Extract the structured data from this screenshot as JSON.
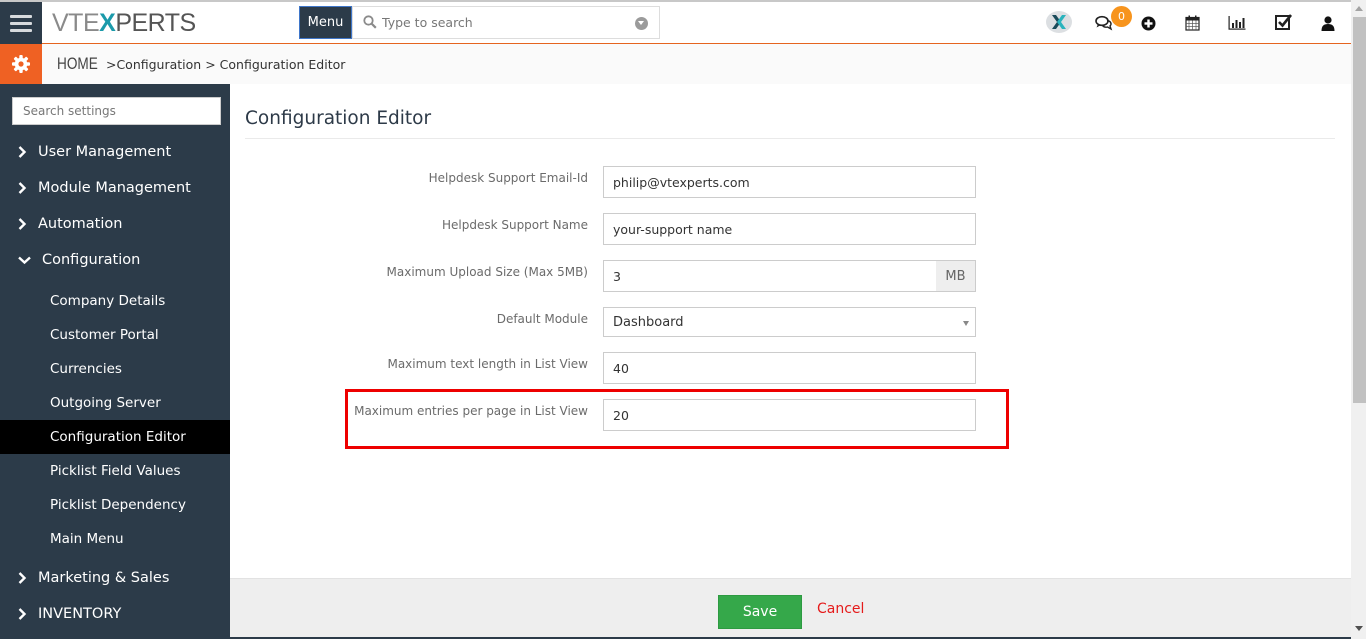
{
  "header": {
    "logo_text": {
      "pre": "VTE",
      "x": "X",
      "post": "PERTS"
    },
    "menu_label": "Menu",
    "search_placeholder": "Type to search",
    "notification_count": "0",
    "icons": [
      "vtexperts-logo-icon",
      "chat-icon",
      "add-circle-icon",
      "calendar-icon",
      "reports-chart-icon",
      "tasks-checkbox-icon",
      "user-icon"
    ]
  },
  "breadcrumb": {
    "home": "HOME",
    "sep1": " >",
    "level1": "Configuration",
    "sep2": " > ",
    "level2": "Configuration Editor"
  },
  "sidebar": {
    "search_placeholder": "Search settings",
    "sections": [
      {
        "label": "User Management",
        "expanded": false
      },
      {
        "label": "Module Management",
        "expanded": false
      },
      {
        "label": "Automation",
        "expanded": false
      },
      {
        "label": "Configuration",
        "expanded": true
      },
      {
        "label": "Marketing & Sales",
        "expanded": false
      },
      {
        "label": "INVENTORY",
        "expanded": false
      }
    ],
    "config_items": [
      {
        "label": "Company Details",
        "active": false
      },
      {
        "label": "Customer Portal",
        "active": false
      },
      {
        "label": "Currencies",
        "active": false
      },
      {
        "label": "Outgoing Server",
        "active": false
      },
      {
        "label": "Configuration Editor",
        "active": true
      },
      {
        "label": "Picklist Field Values",
        "active": false
      },
      {
        "label": "Picklist Dependency",
        "active": false
      },
      {
        "label": "Main Menu",
        "active": false
      }
    ]
  },
  "main": {
    "title": "Configuration Editor",
    "fields": [
      {
        "label": "Helpdesk Support Email-Id",
        "value": "philip@vtexperts.com"
      },
      {
        "label": "Helpdesk Support Name",
        "value": "your-support name"
      },
      {
        "label": "Maximum Upload Size (Max 5MB)",
        "value": "3",
        "addon": "MB"
      },
      {
        "label": "Default Module",
        "value": "Dashboard",
        "type": "select"
      },
      {
        "label": "Maximum text length in List View",
        "value": "40"
      },
      {
        "label": "Maximum entries per page in List View",
        "value": "20",
        "highlighted": true
      }
    ]
  },
  "footer": {
    "save_label": "Save",
    "cancel_label": "Cancel"
  },
  "colors": {
    "brand_orange": "#ef6123",
    "sidebar_bg": "#2c3b49",
    "save_green": "#35a84a",
    "cancel_red": "#e51b1b",
    "highlight_red": "#ee0000",
    "badge_orange": "#f7941d"
  }
}
